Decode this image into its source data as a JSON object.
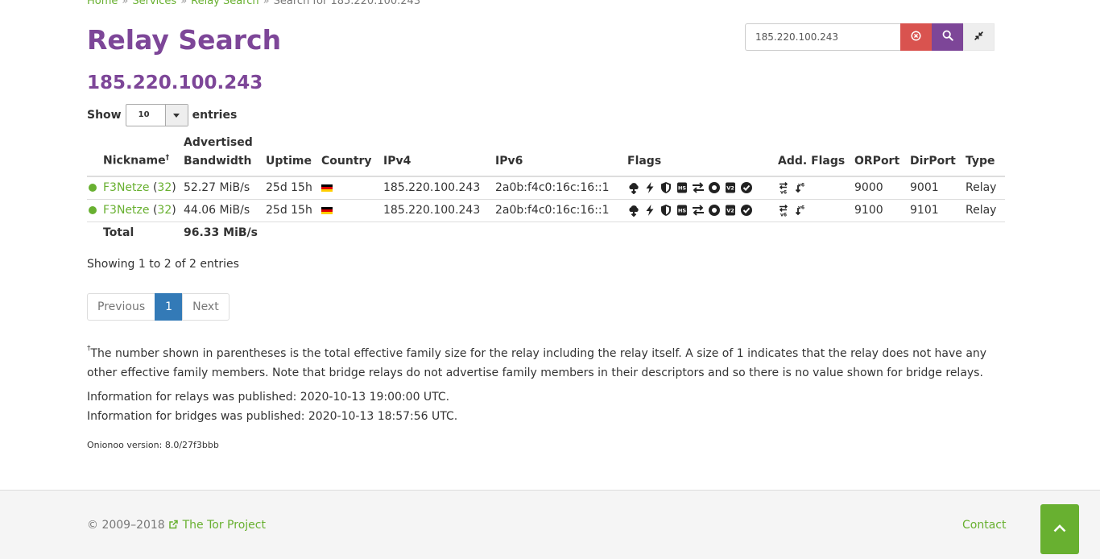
{
  "breadcrumb": {
    "home": "Home",
    "services": "Services",
    "relay_search": "Relay Search",
    "current": "Search for 185.220.100.243"
  },
  "page": {
    "title": "Relay Search",
    "subtitle": "185.220.100.243"
  },
  "search": {
    "value": "185.220.100.243"
  },
  "entries_control": {
    "show_label": "Show",
    "value": "10",
    "entries_label": "entries"
  },
  "table": {
    "headers": {
      "nickname": "Nickname",
      "nickname_mark": "†",
      "bandwidth_line1": "Advertised",
      "bandwidth_line2": "Bandwidth",
      "uptime": "Uptime",
      "country": "Country",
      "ipv4": "IPv4",
      "ipv6": "IPv6",
      "flags": "Flags",
      "add_flags": "Add. Flags",
      "orport": "ORPort",
      "dirport": "DirPort",
      "type": "Type"
    },
    "rows": [
      {
        "nickname": "F3Netze",
        "family_open": "(",
        "family_size": "32",
        "family_close": ")",
        "bandwidth": "52.27 MiB/s",
        "uptime": "25d 15h",
        "ipv4": "185.220.100.243",
        "ipv6": "2a0b:f4c0:16c:16::1",
        "orport": "9000",
        "dirport": "9001",
        "type": "Relay"
      },
      {
        "nickname": "F3Netze",
        "family_open": "(",
        "family_size": "32",
        "family_close": ")",
        "bandwidth": "44.06 MiB/s",
        "uptime": "25d 15h",
        "ipv4": "185.220.100.243",
        "ipv6": "2a0b:f4c0:16c:16::1",
        "orport": "9100",
        "dirport": "9101",
        "type": "Relay"
      }
    ],
    "total": {
      "label": "Total",
      "bandwidth": "96.33 MiB/s"
    }
  },
  "showing_text": "Showing 1 to 2 of 2 entries",
  "pagination": {
    "previous": "Previous",
    "page": "1",
    "next": "Next"
  },
  "footnote": {
    "mark": "†",
    "text": "The number shown in parentheses is the total effective family size for the relay including the relay itself. A size of 1 indicates that the relay does not have any other effective family members. Note that bridge relays do not advertise family members in their descriptors and so there is no value shown for bridge relays."
  },
  "published": {
    "relays": "Information for relays was published: 2020-10-13 19:00:00 UTC.",
    "bridges": "Information for bridges was published: 2020-10-13 18:57:56 UTC."
  },
  "onionoo": "Onionoo version: 8.0/27f3bbb",
  "footer": {
    "copyright": "© 2009–2018",
    "tor_project": "The Tor Project",
    "contact": "Contact"
  },
  "colors": {
    "accent_purple": "#7d4698",
    "link_green": "#68b030",
    "danger": "#d9534f",
    "pagination_active": "#337ab7"
  },
  "icons": {
    "search_clear": "times-circle-icon",
    "search_submit": "search-icon",
    "compact_toggle": "compress-icon",
    "status": "running-dot-icon",
    "flags": [
      "hsdir-icon",
      "fast-icon",
      "guard-icon",
      "hsdir-badge-icon",
      "stable-icon",
      "running-icon",
      "v2dir-icon",
      "valid-icon"
    ],
    "add_flags": [
      "ipv6-exit-icon",
      "ipv6-reachable-icon"
    ],
    "back_to_top": "chevron-up-icon"
  }
}
